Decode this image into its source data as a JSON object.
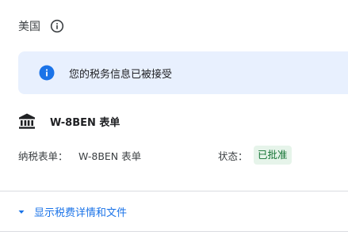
{
  "country": {
    "name": "美国",
    "info_icon": "info-outline-icon"
  },
  "banner": {
    "icon": "info-filled-icon",
    "message": "您的税务信息已被接受",
    "background": "#e8f0fe",
    "icon_color": "#1a73e8"
  },
  "form": {
    "icon": "bank-icon",
    "title": "W-8BEN 表单"
  },
  "details": {
    "tax_form_label": "纳税表单：",
    "tax_form_value": "W-8BEN 表单",
    "status_label": "状态：",
    "status_value": "已批准",
    "status_bg": "#e6f4ea",
    "status_color": "#137333"
  },
  "toggle": {
    "icon": "caret-down-icon",
    "label": "显示税费详情和文件",
    "color": "#1a73e8"
  }
}
